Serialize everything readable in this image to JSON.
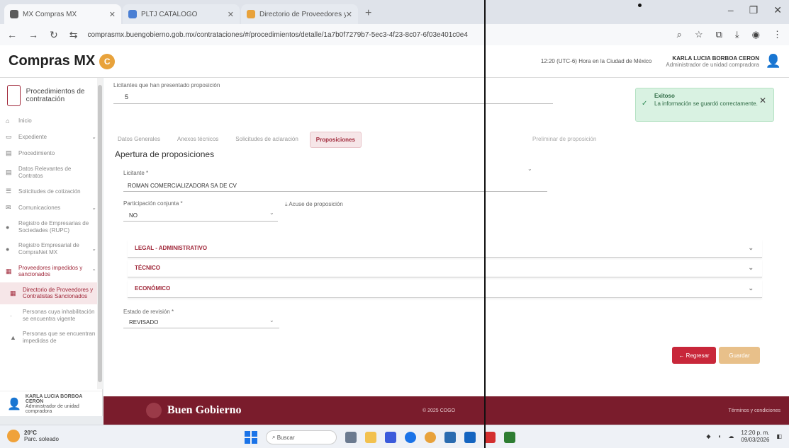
{
  "browser": {
    "tabs": [
      {
        "label": "MX Compras MX",
        "favicon_color": "#5b5b5b"
      },
      {
        "label": "PLTJ CATALOGO",
        "favicon_color": "#4a7fd4"
      },
      {
        "label": "Directorio de Proveedores y C",
        "favicon_color": "#e8a23b"
      }
    ],
    "new_tab": "+",
    "url": "comprasmx.buengobierno.gob.mx/contrataciones/#/procedimientos/detalle/1a7b0f7279b7-5ec3-4f23-8c07-6f03e401c0e4"
  },
  "header": {
    "logo_text": "Compras MX",
    "time_text": "12:20 (UTC-6) Hora en la Ciudad de México",
    "user_name": "KARLA LUCIA BORBOA CERON",
    "user_role": "Administrador de unidad compradora"
  },
  "sidebar": {
    "title": "Procedimientos de contratación",
    "items": [
      {
        "label": "Inicio",
        "icon": "home-icon",
        "chev": ""
      },
      {
        "label": "Expediente",
        "icon": "folder-icon",
        "chev": "⌄"
      },
      {
        "label": "Procedimiento",
        "icon": "doc-icon",
        "chev": ""
      },
      {
        "label": "Datos Relevantes de Contratos",
        "icon": "doc-icon",
        "chev": ""
      },
      {
        "label": "Solicitudes de cotización",
        "icon": "list-icon",
        "chev": ""
      },
      {
        "label": "Comunicaciones",
        "icon": "chat-icon",
        "chev": "⌄"
      },
      {
        "label": "Registro de Empresarias de Sociedades (RUPC)",
        "icon": "user-icon",
        "chev": ""
      },
      {
        "label": "Registro Empresarial de CompraNet MX",
        "icon": "user-icon",
        "chev": "⌄"
      }
    ],
    "providers": {
      "label": "Proveedores impedidos y sancionados",
      "chev": "⌃"
    },
    "selected": {
      "label": "Directorio de Proveedores y Contratistas Sancionados"
    },
    "sub_items": [
      {
        "label": "Personas cuya inhabilitación se encuentra vigente"
      },
      {
        "label": "Personas que se encuentran impedidas de"
      }
    ],
    "user": {
      "name": "KARLA LUCIA BORBOA CERON",
      "role": "Administrador de unidad compradora"
    }
  },
  "form": {
    "licitantes_label": "Licitantes que han presentado proposición",
    "licitantes_value": "5",
    "tabs": [
      "Datos Generales",
      "Anexos técnicos",
      "Solicitudes de aclaración",
      "Proposiciones"
    ],
    "tab_right": "Preliminar de proposición",
    "active_tab": "Proposiciones",
    "section_title": "Apertura de proposiciones",
    "licitante_label": "Licitante *",
    "licitante_value": "ROMAN COMERCIALIZADORA SA DE CV",
    "participacion_label": "Participación conjunta *",
    "participacion_value": "NO",
    "acuse_label": "Acuse de proposición",
    "accordions": [
      "LEGAL - ADMINISTRATIVO",
      "TÉCNICO",
      "ECONÓMICO"
    ],
    "estado_label": "Estado de revisión *",
    "estado_value": "REVISADO",
    "btn_back": "← Regresar",
    "btn_save": "Guardar"
  },
  "toast": {
    "title": "Exitoso",
    "message": "La información se guardó correctamente."
  },
  "footer": {
    "brand": "Buen Gobierno",
    "center": "© 2025 COGO",
    "right": "Términos y condiciones"
  },
  "taskbar": {
    "temp": "20°C",
    "weather": "Parc. soleado",
    "search": "Buscar",
    "time": "12:20 p. m.",
    "date": "09/03/2026"
  },
  "colors": {
    "brand": "#a0283a",
    "footer": "#7a1c2c",
    "toast": "#d9f2e2",
    "back_btn": "#c8273a",
    "save_btn": "#e8c08a"
  }
}
